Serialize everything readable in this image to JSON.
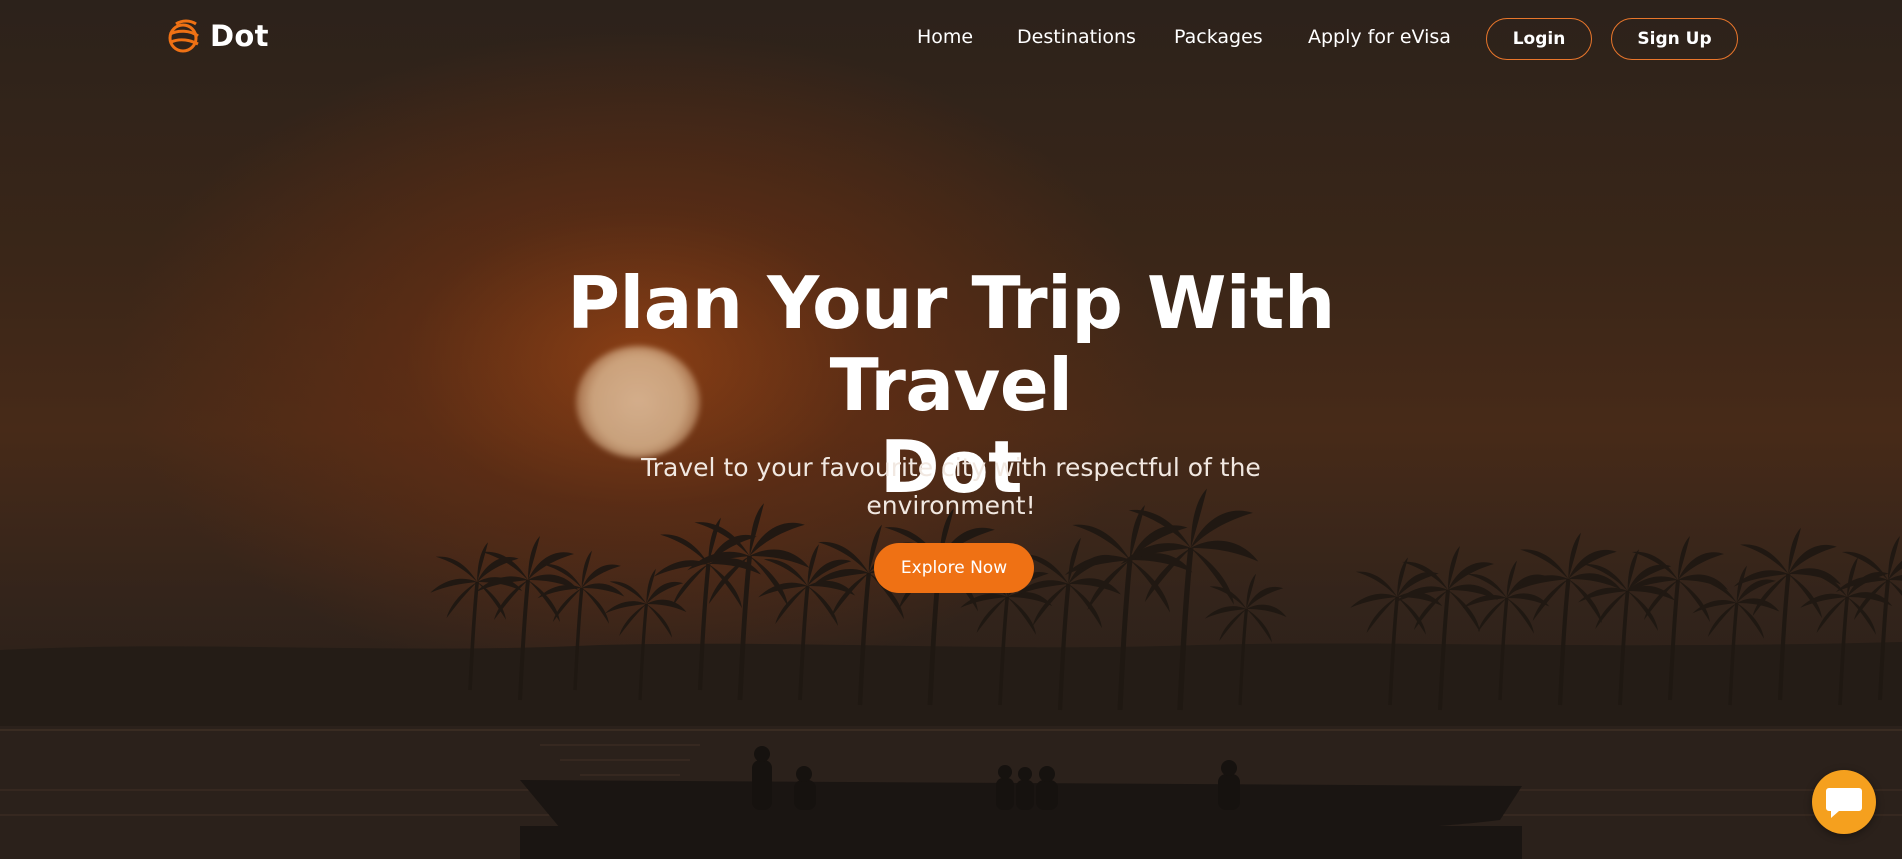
{
  "brand": {
    "name": "Dot",
    "accent_color": "#ef7114",
    "logo_icon": "globe-icon"
  },
  "nav": {
    "links": [
      {
        "label": "Home"
      },
      {
        "label": "Destinations"
      },
      {
        "label": "Packages"
      },
      {
        "label": "Apply for eVisa"
      }
    ],
    "login_label": "Login",
    "signup_label": "Sign Up"
  },
  "hero": {
    "title_line1": "Plan Your Trip With Travel",
    "title_line2": "Dot",
    "subtitle_line1": "Travel to your favourite city with respectful of the",
    "subtitle_line2": "environment!",
    "cta_label": "Explore Now",
    "background_image": "sunset-backwaters-palm-trees-boat"
  },
  "chat_widget": {
    "icon": "chat-bubble-icon",
    "color": "#f5a01e"
  }
}
